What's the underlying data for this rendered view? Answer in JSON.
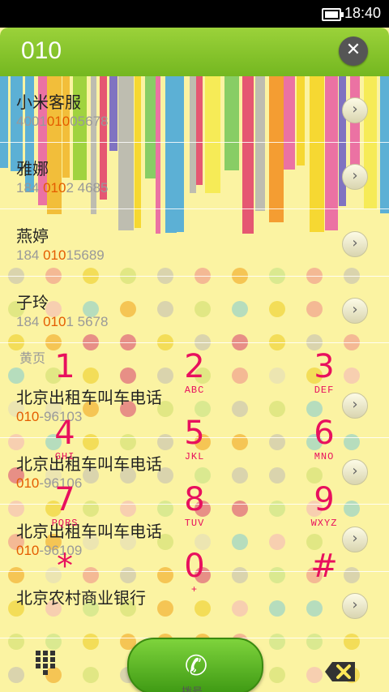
{
  "status": {
    "time": "18:40"
  },
  "header": {
    "query": "010"
  },
  "contacts": [
    {
      "name": "小米客服",
      "num_pre": "4001",
      "num_hl": "010",
      "num_post": "05678"
    },
    {
      "name": "雅娜",
      "num_pre": "184 ",
      "num_hl": "010",
      "num_post": "2 4685"
    },
    {
      "name": "燕婷",
      "num_pre": "184 ",
      "num_hl": "010",
      "num_post": "15689"
    },
    {
      "name": "子玲",
      "num_pre": "184 ",
      "num_hl": "010",
      "num_post": "1 5678"
    }
  ],
  "yellow_pages_label": "黄页",
  "yellow_pages": [
    {
      "name": "北京出租车叫车电话",
      "num_pre": "",
      "num_hl": "010",
      "num_post": "-96103"
    },
    {
      "name": "北京出租车叫车电话",
      "num_pre": "",
      "num_hl": "010",
      "num_post": "-96106"
    },
    {
      "name": "北京出租车叫车电话",
      "num_pre": "",
      "num_hl": "010",
      "num_post": "-96109"
    },
    {
      "name": "北京农村商业银行",
      "num_pre": "",
      "num_hl": "",
      "num_post": ""
    }
  ],
  "keypad": [
    {
      "digit": "1",
      "letters": ""
    },
    {
      "digit": "2",
      "letters": "ABC"
    },
    {
      "digit": "3",
      "letters": "DEF"
    },
    {
      "digit": "4",
      "letters": "GHI"
    },
    {
      "digit": "5",
      "letters": "JKL"
    },
    {
      "digit": "6",
      "letters": "MNO"
    },
    {
      "digit": "7",
      "letters": "PQRS"
    },
    {
      "digit": "8",
      "letters": "TUV"
    },
    {
      "digit": "9",
      "letters": "WXYZ"
    },
    {
      "digit": "*",
      "letters": ""
    },
    {
      "digit": "0",
      "letters": "+"
    },
    {
      "digit": "#",
      "letters": ""
    }
  ],
  "bottom": {
    "call_label": "拨号"
  },
  "colors": {
    "accent_green": "#7cc52a",
    "key_pink": "#e8105e",
    "highlight_orange": "#e45c00",
    "background": "#fbf3a2"
  },
  "icons": [
    "battery-icon",
    "clear-icon",
    "chevron-right-icon",
    "dialpad-grid-icon",
    "phone-icon",
    "backspace-icon"
  ]
}
